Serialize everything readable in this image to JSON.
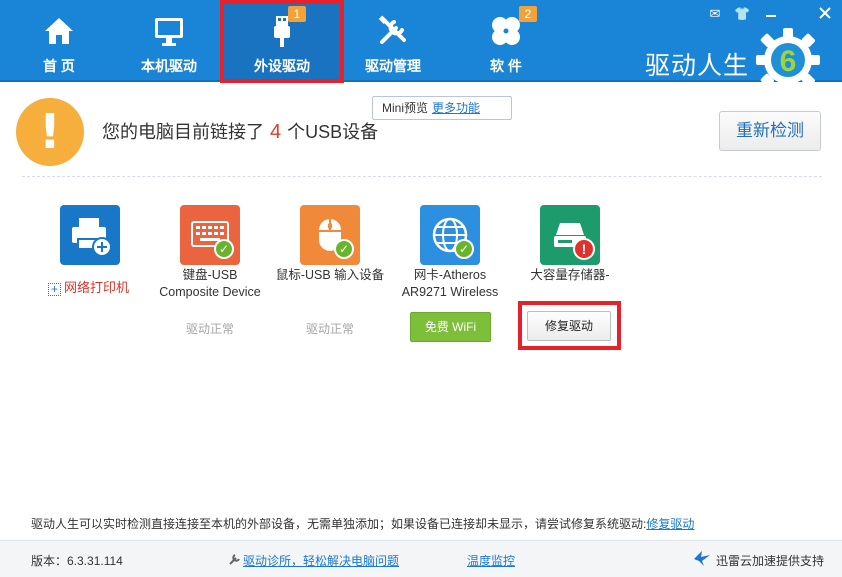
{
  "nav": {
    "items": [
      {
        "label": "首 页",
        "icon": "home-icon"
      },
      {
        "label": "本机驱动",
        "icon": "monitor-icon"
      },
      {
        "label": "外设驱动",
        "icon": "usb-icon",
        "badge": "1"
      },
      {
        "label": "驱动管理",
        "icon": "tools-icon"
      },
      {
        "label": "软 件",
        "icon": "clover-icon",
        "badge": "2"
      }
    ],
    "active_index": 2
  },
  "brand": {
    "name": "驱动人生",
    "logo_digit": "6"
  },
  "window_controls": [
    "message-icon",
    "skin-icon",
    "minimize-icon",
    "close-icon"
  ],
  "status": {
    "prefix": "您的电脑目前链接了",
    "count": "4",
    "suffix": "个USB设备"
  },
  "tooltip": {
    "text": "Mini预览",
    "link": "更多功能"
  },
  "recheck_label": "重新检测",
  "devices": [
    {
      "name": "网络打印机",
      "status": ""
    },
    {
      "name_line1": "键盘-USB",
      "name_line2": "Composite Device",
      "status": "驱动正常"
    },
    {
      "name_line1": "鼠标-USB 输入设备",
      "status": "驱动正常"
    },
    {
      "name_line1": "网卡-Atheros",
      "name_line2": "AR9271 Wireless",
      "action": "免费 WiFi"
    },
    {
      "name_line1": "大容量存储器-",
      "action": "修复驱动"
    }
  ],
  "hint": {
    "text": "驱动人生可以实时检测直接连接至本机的外部设备，无需单独添加；如果设备已连接却未显示，请尝试修复系统驱动:",
    "link": "修复驱动"
  },
  "footer": {
    "version": "版本：6.3.31.114",
    "diag_link": "驱动诊所，轻松解决电脑问题",
    "temp_link": "温度监控",
    "cloud": "迅雷云加速提供支持"
  },
  "colors": {
    "header": "#1a84d6",
    "warning": "#f6ae3c",
    "accent_red": "#e8202a",
    "link": "#1a78d0"
  }
}
